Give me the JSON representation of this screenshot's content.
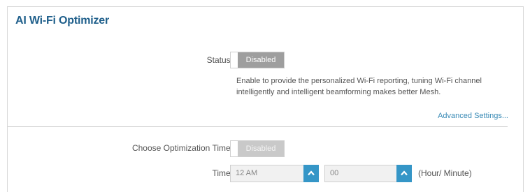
{
  "header": {
    "title": "AI Wi-Fi Optimizer"
  },
  "status": {
    "label": "Status:",
    "toggle_state": "Disabled",
    "description": "Enable to provide the personalized Wi-Fi reporting, tuning Wi-Fi channel intelligently and intelligent beamforming makes better Mesh.",
    "advanced_link": "Advanced Settings..."
  },
  "optimization": {
    "label": "Choose Optimization Time:",
    "toggle_state": "Disabled",
    "time_label": "Time:",
    "hour_value": "12 AM",
    "minute_value": "00",
    "unit_hint": "(Hour/ Minute)"
  },
  "colors": {
    "title": "#1f5f8b",
    "link": "#3a8bb6",
    "dropdown_button": "#3596c7",
    "toggle_off": "#9e9e9e"
  },
  "icons": {
    "dropdown": "chevron-up-icon"
  }
}
